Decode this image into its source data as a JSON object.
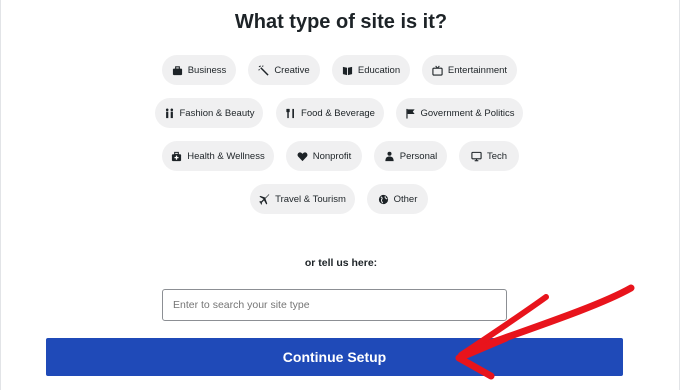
{
  "heading": "What type of site is it?",
  "categories": [
    {
      "label": "Business",
      "icon": "briefcase-icon"
    },
    {
      "label": "Creative",
      "icon": "magic-wand-icon"
    },
    {
      "label": "Education",
      "icon": "book-icon"
    },
    {
      "label": "Entertainment",
      "icon": "tv-icon"
    },
    {
      "label": "Fashion & Beauty",
      "icon": "people-icon"
    },
    {
      "label": "Food & Beverage",
      "icon": "utensils-icon"
    },
    {
      "label": "Government & Politics",
      "icon": "flag-icon"
    },
    {
      "label": "Health & Wellness",
      "icon": "medical-kit-icon"
    },
    {
      "label": "Nonprofit",
      "icon": "heart-icon"
    },
    {
      "label": "Personal",
      "icon": "person-icon"
    },
    {
      "label": "Tech",
      "icon": "monitor-icon"
    },
    {
      "label": "Travel & Tourism",
      "icon": "airplane-icon"
    },
    {
      "label": "Other",
      "icon": "globe-icon"
    }
  ],
  "custom": {
    "label": "or tell us here:",
    "placeholder": "Enter to search your site type",
    "value": ""
  },
  "continue_label": "Continue Setup",
  "colors": {
    "primary_button": "#1f4ab8",
    "chip_background": "#f0f0f1",
    "annotation_arrow": "#e8141c"
  }
}
